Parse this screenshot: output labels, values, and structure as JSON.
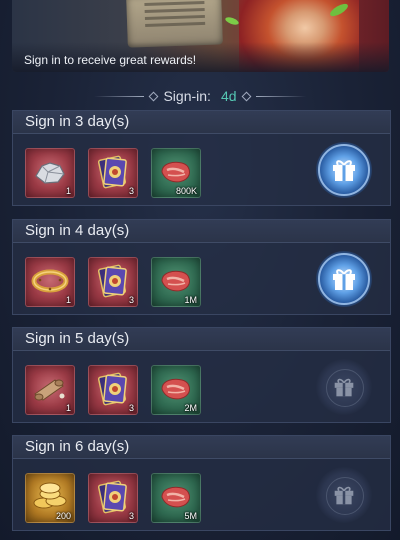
{
  "banner": {
    "caption": "Sign in to receive great rewards!"
  },
  "signin": {
    "label": "Sign-in:",
    "days": "4d"
  },
  "colors": {
    "accent_teal": "#55c7b3",
    "card_bg": "#262f46",
    "gift_active": "#5fa0e6"
  },
  "rewards": [
    {
      "title": "Sign in 3 day(s)",
      "gift_state": "claimable",
      "items": [
        {
          "icon": "silver-ore-icon",
          "qty": "1"
        },
        {
          "icon": "card-pack-icon",
          "qty": "3"
        },
        {
          "icon": "meat-icon",
          "qty": "800K"
        }
      ]
    },
    {
      "title": "Sign in 4 day(s)",
      "gift_state": "claimable",
      "items": [
        {
          "icon": "gold-ring-icon",
          "qty": "1"
        },
        {
          "icon": "card-pack-icon",
          "qty": "3"
        },
        {
          "icon": "meat-icon",
          "qty": "1M"
        }
      ]
    },
    {
      "title": "Sign in 5 day(s)",
      "gift_state": "locked",
      "items": [
        {
          "icon": "scroll-icon",
          "qty": "1"
        },
        {
          "icon": "card-pack-icon",
          "qty": "3"
        },
        {
          "icon": "meat-icon",
          "qty": "2M"
        }
      ]
    },
    {
      "title": "Sign in 6 day(s)",
      "gift_state": "locked",
      "items": [
        {
          "icon": "gold-coins-icon",
          "qty": "200"
        },
        {
          "icon": "card-pack-icon",
          "qty": "3"
        },
        {
          "icon": "meat-icon",
          "qty": "5M"
        }
      ]
    }
  ]
}
